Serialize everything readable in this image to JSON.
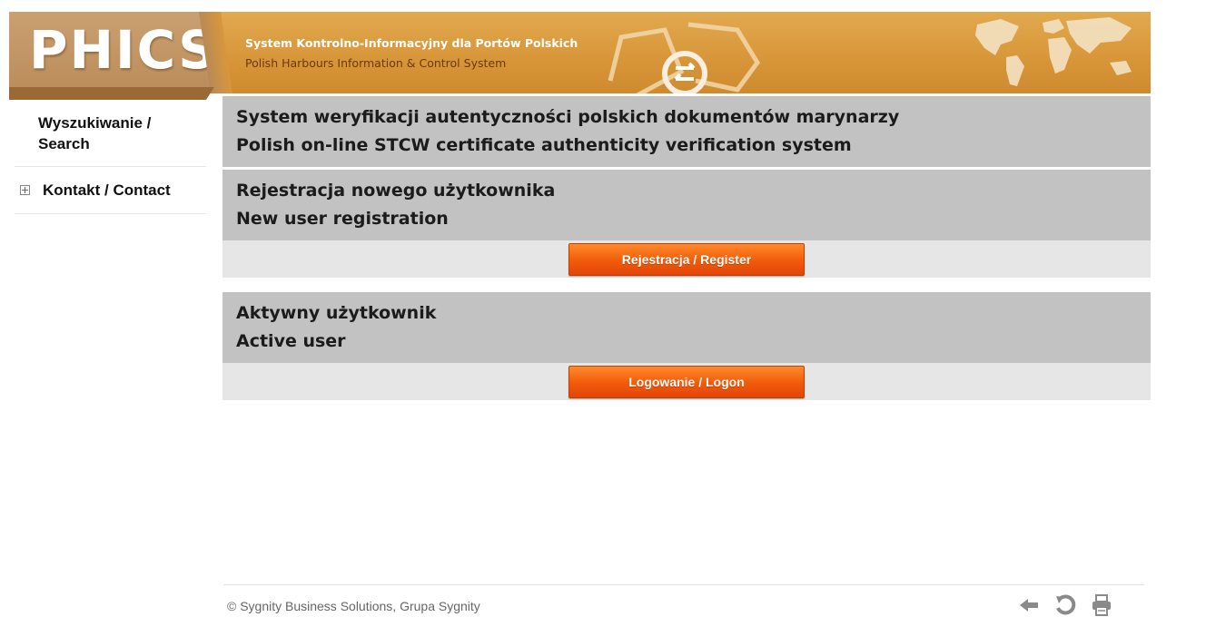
{
  "header": {
    "logo": "PHICS",
    "subtitle_pl": "System Kontrolno-Informacyjny dla Portów Polskich",
    "subtitle_en": "Polish Harbours Information & Control System"
  },
  "sidebar": {
    "items": [
      {
        "label_line1": "Wyszukiwanie /",
        "label_line2": "Search",
        "expand_icon": "none"
      },
      {
        "label": "Kontakt / Contact",
        "expand_icon": "plus-square-icon"
      }
    ]
  },
  "main": {
    "system_title": {
      "pl": "System weryfikacji autentyczności polskich dokumentów marynarzy",
      "en": "Polish on-line STCW certificate authenticity verification system"
    },
    "registration": {
      "title_pl": "Rejestracja nowego użytkownika",
      "title_en": "New user registration",
      "button_label": "Rejestracja / Register"
    },
    "active_user": {
      "title_pl": "Aktywny użytkownik",
      "title_en": "Active user",
      "button_label": "Logowanie / Logon"
    }
  },
  "footer": {
    "copyright": "© Sygnity Business Solutions, Grupa Sygnity",
    "icons": [
      "back-arrow-icon",
      "refresh-icon",
      "print-icon"
    ]
  },
  "colors": {
    "banner": "#d8973a",
    "logo_bg": "#b98a57",
    "title_bar": "#c2c2c2",
    "action_bar": "#e6e6e6",
    "button": "#f15a0a"
  }
}
